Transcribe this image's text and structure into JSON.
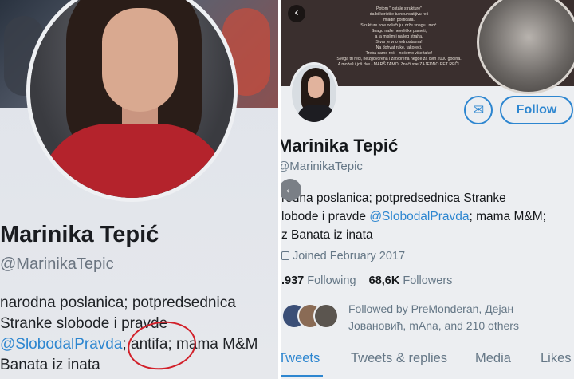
{
  "left": {
    "name": "Marinika Tepić",
    "handle": "@MarinikaTepic",
    "bio_line1": "narodna poslanica; potpredsednica",
    "bio_line2": "Stranke slobode i pravde",
    "bio_mention": "@SlobodalPravda",
    "bio_line3_rest": "; antifa; mama M&M",
    "bio_line4": "Banata iz inata",
    "circle_color": "#d2202a"
  },
  "right": {
    "banner_poem": [
      "Potom \" ostale strukture\"",
      "da bi koristile tu neuhvatljivu reč",
      "mladih političara.",
      "Strukture koje odlučuju, drže snagu i moć.",
      "Snagu naše neveličke pameti,",
      "a ja mislim i našeg straha.",
      "Stvar je vrlo jednostavna!",
      "Na dohvat ruke, takoreći.",
      "Treba samo reći - nećemo više tako!",
      "Svega tri reči, neizgovorena i zatvorena negde za ovih 2000 godina.",
      "A možeš i još dve - MARŠ TAMO. Znači sve ZAJEDNO PET REČI."
    ],
    "back_icon": "‹",
    "mail_icon": "✉",
    "follow_label": "Follow",
    "name": "Marinika Tepić",
    "handle": "@MarinikaTepic",
    "bio_line1": "rodna poslanica; potpredsednica Stranke",
    "bio_line2_pre": "lobode i pravde ",
    "bio_mention": "@SlobodalPravda",
    "bio_line2_post": "; mama M&M;",
    "bio_line3": "z Banata iz inata",
    "joined": "Joined February 2017",
    "following_count": ".937",
    "following_label": "Following",
    "followers_count": "68,6K",
    "followers_label": "Followers",
    "followed_by_line1": "Followed by PreMonderan, Дејан",
    "followed_by_line2": "Јовановић, mAna, and 210 others",
    "tabs": [
      "Tweets",
      "Tweets & replies",
      "Media",
      "Likes"
    ],
    "accent": "#2d86d0"
  }
}
